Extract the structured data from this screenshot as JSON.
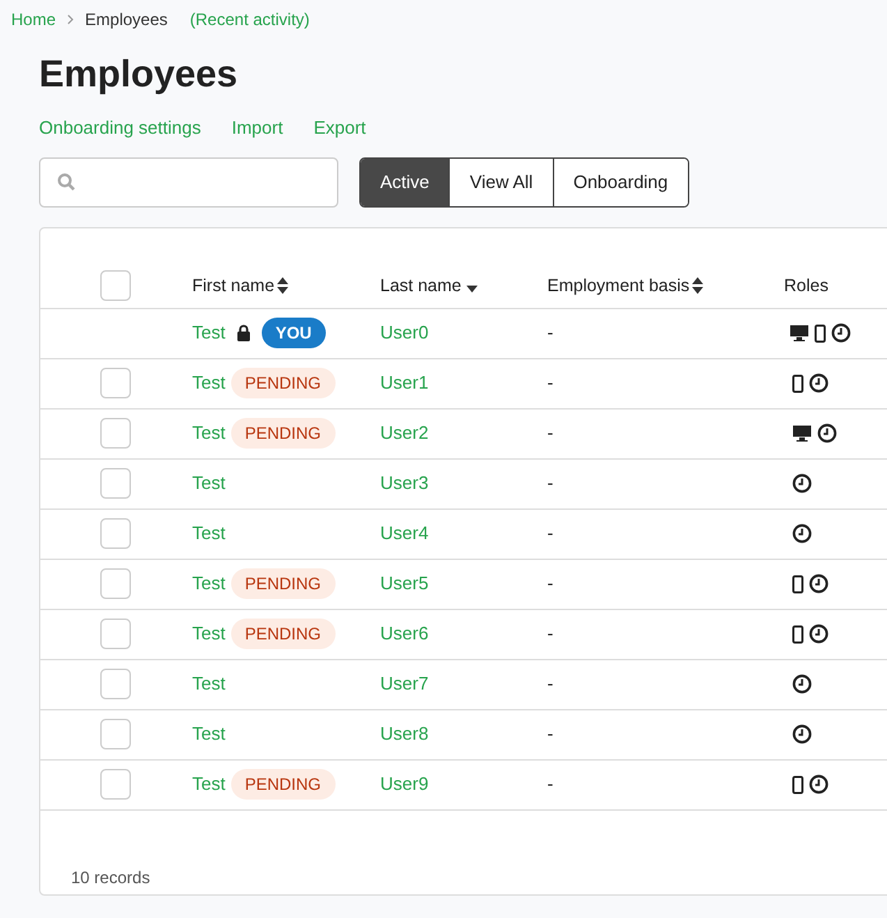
{
  "breadcrumb": [
    {
      "label": "Home",
      "kind": "link"
    },
    {
      "label": "Employees",
      "kind": "current"
    },
    {
      "label": "(Recent activity)",
      "kind": "link"
    }
  ],
  "title": "Employees",
  "actions": [
    "Onboarding settings",
    "Import",
    "Export"
  ],
  "filters": [
    {
      "label": "Active",
      "selected": true
    },
    {
      "label": "View All",
      "selected": false
    },
    {
      "label": "Onboarding",
      "selected": false
    }
  ],
  "table": {
    "select_all": {
      "checked": false
    },
    "columns": [
      {
        "label": "First name",
        "sort": {
          "kind": "both"
        }
      },
      {
        "label": "Last name",
        "sort": {
          "kind": "desc"
        }
      },
      {
        "label": "Employment basis",
        "sort": {
          "kind": "both"
        }
      },
      {
        "label": "Roles"
      }
    ],
    "rows": [
      {
        "first": "Test",
        "locked": true,
        "badge": {
          "kind": "you",
          "text": "YOU"
        },
        "last": "User0",
        "basis": "-",
        "roles": [
          {
            "kind": "desktop"
          },
          {
            "kind": "mobile"
          },
          {
            "kind": "clock"
          }
        ]
      },
      {
        "checked": false,
        "first": "Test",
        "locked": false,
        "badge": {
          "kind": "pending",
          "text": "PENDING"
        },
        "last": "User1",
        "basis": "-",
        "roles": [
          {
            "kind": "mobile"
          },
          {
            "kind": "clock"
          }
        ]
      },
      {
        "checked": false,
        "first": "Test",
        "locked": false,
        "badge": {
          "kind": "pending",
          "text": "PENDING"
        },
        "last": "User2",
        "basis": "-",
        "roles": [
          {
            "kind": "desktop"
          },
          {
            "kind": "clock"
          }
        ]
      },
      {
        "checked": false,
        "first": "Test",
        "locked": false,
        "last": "User3",
        "basis": "-",
        "roles": [
          {
            "kind": "clock"
          }
        ]
      },
      {
        "checked": false,
        "first": "Test",
        "locked": false,
        "last": "User4",
        "basis": "-",
        "roles": [
          {
            "kind": "clock"
          }
        ]
      },
      {
        "checked": false,
        "first": "Test",
        "locked": false,
        "badge": {
          "kind": "pending",
          "text": "PENDING"
        },
        "last": "User5",
        "basis": "-",
        "roles": [
          {
            "kind": "mobile"
          },
          {
            "kind": "clock"
          }
        ]
      },
      {
        "checked": false,
        "first": "Test",
        "locked": false,
        "badge": {
          "kind": "pending",
          "text": "PENDING"
        },
        "last": "User6",
        "basis": "-",
        "roles": [
          {
            "kind": "mobile"
          },
          {
            "kind": "clock"
          }
        ]
      },
      {
        "checked": false,
        "first": "Test",
        "locked": false,
        "last": "User7",
        "basis": "-",
        "roles": [
          {
            "kind": "clock"
          }
        ]
      },
      {
        "checked": false,
        "first": "Test",
        "locked": false,
        "last": "User8",
        "basis": "-",
        "roles": [
          {
            "kind": "clock"
          }
        ]
      },
      {
        "checked": false,
        "first": "Test",
        "locked": false,
        "badge": {
          "kind": "pending",
          "text": "PENDING"
        },
        "last": "User9",
        "basis": "-",
        "roles": [
          {
            "kind": "mobile"
          },
          {
            "kind": "clock"
          }
        ]
      }
    ],
    "footer": "10 records"
  }
}
